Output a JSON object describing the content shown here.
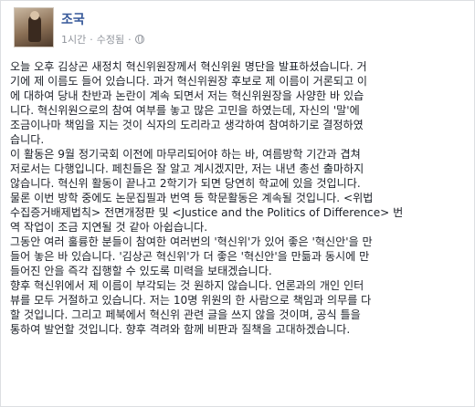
{
  "post": {
    "author": "조국",
    "timestamp": "1시간",
    "edited": "수정됨",
    "privacy_icon": "globe-icon",
    "paragraphs": [
      [
        "오늘 오후 김상곤 새정치 혁신위원장께서 혁신위원 명단을 발표하셨습니다. 거",
        "기에 제 이름도 들어 있습니다. 과거 혁신위원장 후보로 제 이름이 거론되고 이",
        "에 대하여 당내 찬반과 논란이 계속 되면서 저는 혁신위원장을 사양한 바 있습",
        "니다. 혁신위원으로의 참여 여부를 놓고 많은 고민을 하였는데, 자신의 '말'에",
        "조금이나마 책임을 지는 것이 식자의 도리라고 생각하여 참여하기로 결정하였",
        "습니다."
      ],
      [
        "이 활동은 9월 정기국회 이전에 마무리되어야 하는 바, 여름방학 기간과 겹쳐",
        "저로서는 다행입니다. 페친들은 잘 알고 계시겠지만, 저는 내년 총선 출마하지",
        "않습니다. 혁신위 활동이 끝나고 2학기가 되면 당연히 학교에 있을 것입니다.",
        "물론 이번 방학 중에도 논문집필과 번역 등 학문활동은 계속될 것입니다. <위법",
        "수집증거배제법칙> 전면개정판 및 <Justice and the Politics of Difference> 번",
        "역 작업이 조금 지연될 것 같아 아쉽습니다."
      ],
      [
        "그동안 여러 훌륭한 분들이 참여한 여러번의 '혁신위'가 있어 좋은 '혁신안'을 만",
        "들어 놓은 바 있습니다. '김상곤 혁신위'가 더 좋은 '혁신안'을 만듦과 동시에 만",
        "들어진 안을 즉각 집행할 수 있도록 미력을 보태겠습니다."
      ],
      [
        "향후 혁신위에서 제 이름이 부각되는 것 원하지 않습니다. 언론과의 개인 인터",
        "뷰를 모두 거절하고 있습니다. 저는 10명 위원의 한 사람으로 책임과 의무를 다",
        "할 것입니다. 그리고 페북에서 혁신위 관련 글을 쓰지 않을 것이며, 공식 틀을",
        "통하여 발언할 것입니다. 향후 격려와 함께 비판과 질책을 고대하겠습니다."
      ]
    ]
  },
  "colors": {
    "author_link": "#365899",
    "meta_gray": "#90949c",
    "text": "#1d2129"
  }
}
